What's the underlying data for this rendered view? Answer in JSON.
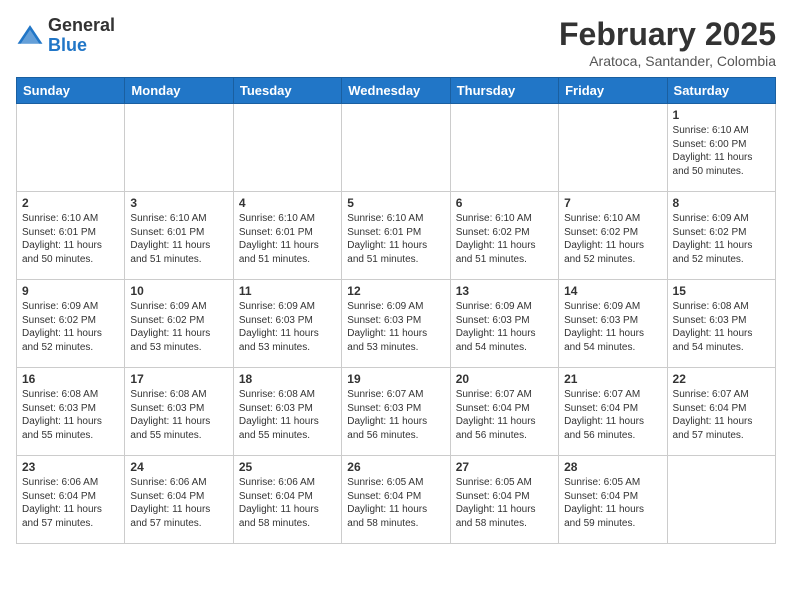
{
  "header": {
    "logo_general": "General",
    "logo_blue": "Blue",
    "month_title": "February 2025",
    "location": "Aratoca, Santander, Colombia"
  },
  "weekdays": [
    "Sunday",
    "Monday",
    "Tuesday",
    "Wednesday",
    "Thursday",
    "Friday",
    "Saturday"
  ],
  "weeks": [
    [
      {
        "day": "",
        "info": ""
      },
      {
        "day": "",
        "info": ""
      },
      {
        "day": "",
        "info": ""
      },
      {
        "day": "",
        "info": ""
      },
      {
        "day": "",
        "info": ""
      },
      {
        "day": "",
        "info": ""
      },
      {
        "day": "1",
        "info": "Sunrise: 6:10 AM\nSunset: 6:00 PM\nDaylight: 11 hours\nand 50 minutes."
      }
    ],
    [
      {
        "day": "2",
        "info": "Sunrise: 6:10 AM\nSunset: 6:01 PM\nDaylight: 11 hours\nand 50 minutes."
      },
      {
        "day": "3",
        "info": "Sunrise: 6:10 AM\nSunset: 6:01 PM\nDaylight: 11 hours\nand 51 minutes."
      },
      {
        "day": "4",
        "info": "Sunrise: 6:10 AM\nSunset: 6:01 PM\nDaylight: 11 hours\nand 51 minutes."
      },
      {
        "day": "5",
        "info": "Sunrise: 6:10 AM\nSunset: 6:01 PM\nDaylight: 11 hours\nand 51 minutes."
      },
      {
        "day": "6",
        "info": "Sunrise: 6:10 AM\nSunset: 6:02 PM\nDaylight: 11 hours\nand 51 minutes."
      },
      {
        "day": "7",
        "info": "Sunrise: 6:10 AM\nSunset: 6:02 PM\nDaylight: 11 hours\nand 52 minutes."
      },
      {
        "day": "8",
        "info": "Sunrise: 6:09 AM\nSunset: 6:02 PM\nDaylight: 11 hours\nand 52 minutes."
      }
    ],
    [
      {
        "day": "9",
        "info": "Sunrise: 6:09 AM\nSunset: 6:02 PM\nDaylight: 11 hours\nand 52 minutes."
      },
      {
        "day": "10",
        "info": "Sunrise: 6:09 AM\nSunset: 6:02 PM\nDaylight: 11 hours\nand 53 minutes."
      },
      {
        "day": "11",
        "info": "Sunrise: 6:09 AM\nSunset: 6:03 PM\nDaylight: 11 hours\nand 53 minutes."
      },
      {
        "day": "12",
        "info": "Sunrise: 6:09 AM\nSunset: 6:03 PM\nDaylight: 11 hours\nand 53 minutes."
      },
      {
        "day": "13",
        "info": "Sunrise: 6:09 AM\nSunset: 6:03 PM\nDaylight: 11 hours\nand 54 minutes."
      },
      {
        "day": "14",
        "info": "Sunrise: 6:09 AM\nSunset: 6:03 PM\nDaylight: 11 hours\nand 54 minutes."
      },
      {
        "day": "15",
        "info": "Sunrise: 6:08 AM\nSunset: 6:03 PM\nDaylight: 11 hours\nand 54 minutes."
      }
    ],
    [
      {
        "day": "16",
        "info": "Sunrise: 6:08 AM\nSunset: 6:03 PM\nDaylight: 11 hours\nand 55 minutes."
      },
      {
        "day": "17",
        "info": "Sunrise: 6:08 AM\nSunset: 6:03 PM\nDaylight: 11 hours\nand 55 minutes."
      },
      {
        "day": "18",
        "info": "Sunrise: 6:08 AM\nSunset: 6:03 PM\nDaylight: 11 hours\nand 55 minutes."
      },
      {
        "day": "19",
        "info": "Sunrise: 6:07 AM\nSunset: 6:03 PM\nDaylight: 11 hours\nand 56 minutes."
      },
      {
        "day": "20",
        "info": "Sunrise: 6:07 AM\nSunset: 6:04 PM\nDaylight: 11 hours\nand 56 minutes."
      },
      {
        "day": "21",
        "info": "Sunrise: 6:07 AM\nSunset: 6:04 PM\nDaylight: 11 hours\nand 56 minutes."
      },
      {
        "day": "22",
        "info": "Sunrise: 6:07 AM\nSunset: 6:04 PM\nDaylight: 11 hours\nand 57 minutes."
      }
    ],
    [
      {
        "day": "23",
        "info": "Sunrise: 6:06 AM\nSunset: 6:04 PM\nDaylight: 11 hours\nand 57 minutes."
      },
      {
        "day": "24",
        "info": "Sunrise: 6:06 AM\nSunset: 6:04 PM\nDaylight: 11 hours\nand 57 minutes."
      },
      {
        "day": "25",
        "info": "Sunrise: 6:06 AM\nSunset: 6:04 PM\nDaylight: 11 hours\nand 58 minutes."
      },
      {
        "day": "26",
        "info": "Sunrise: 6:05 AM\nSunset: 6:04 PM\nDaylight: 11 hours\nand 58 minutes."
      },
      {
        "day": "27",
        "info": "Sunrise: 6:05 AM\nSunset: 6:04 PM\nDaylight: 11 hours\nand 58 minutes."
      },
      {
        "day": "28",
        "info": "Sunrise: 6:05 AM\nSunset: 6:04 PM\nDaylight: 11 hours\nand 59 minutes."
      },
      {
        "day": "",
        "info": ""
      }
    ]
  ]
}
